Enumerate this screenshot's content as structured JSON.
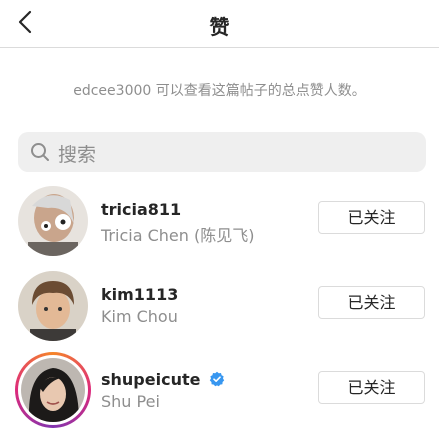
{
  "header": {
    "title": "赞",
    "back_icon": "chevron-left-icon"
  },
  "notice": "edcee3000 可以查看这篇帖子的总点赞人数。",
  "search": {
    "placeholder": "搜索",
    "icon": "search-icon"
  },
  "users": [
    {
      "username": "tricia811",
      "full_name": "Tricia Chen (陈见飞)",
      "verified": false,
      "button": "已关注"
    },
    {
      "username": "kim1113",
      "full_name": "Kim Chou",
      "verified": false,
      "button": "已关注"
    },
    {
      "username": "shupeicute",
      "full_name": "Shu Pei",
      "verified": true,
      "button": "已关注",
      "has_story_ring": true
    }
  ],
  "colors": {
    "verified_blue": "#3897f0",
    "secondary_text": "#8e8e8e",
    "border": "#dbdbdb"
  }
}
